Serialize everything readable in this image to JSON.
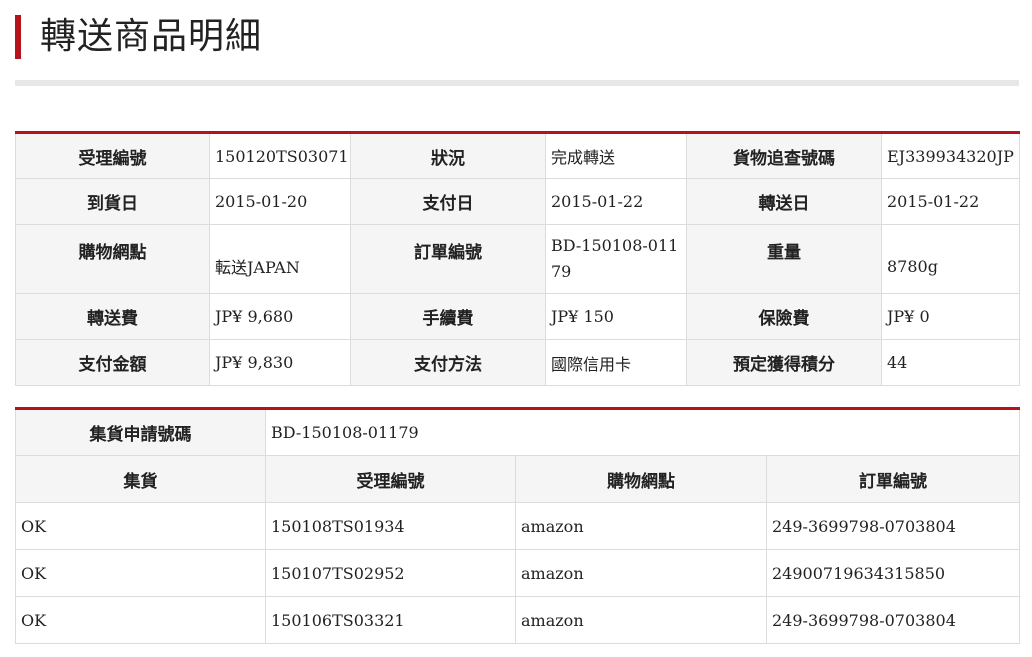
{
  "page": {
    "title": "轉送商品明細"
  },
  "details": {
    "rows": [
      [
        {
          "label": "受理編號",
          "value": "150120TS03071"
        },
        {
          "label": "狀況",
          "value": "完成轉送"
        },
        {
          "label": "貨物追查號碼",
          "value": "EJ339934320JP"
        }
      ],
      [
        {
          "label": "到貨日",
          "value": "2015-01-20"
        },
        {
          "label": "支付日",
          "value": "2015-01-22"
        },
        {
          "label": "轉送日",
          "value": "2015-01-22"
        }
      ],
      [
        {
          "label": "購物網點",
          "value": "転送JAPAN"
        },
        {
          "label": "訂單編號",
          "value": "BD-150108-01179"
        },
        {
          "label": "重量",
          "value": "8780g"
        }
      ],
      [
        {
          "label": "轉送費",
          "value": "JP¥ 9,680"
        },
        {
          "label": "手續費",
          "value": "JP¥ 150"
        },
        {
          "label": "保險費",
          "value": "JP¥ 0"
        }
      ],
      [
        {
          "label": "支付金額",
          "value": "JP¥ 9,830"
        },
        {
          "label": "支付方法",
          "value": "國際信用卡"
        },
        {
          "label": "預定獲得積分",
          "value": "44"
        }
      ]
    ]
  },
  "consolidation": {
    "request_label": "集貨申請號碼",
    "request_value": "BD-150108-01179",
    "headers": [
      "集貨",
      "受理編號",
      "購物網點",
      "訂單編號"
    ],
    "rows": [
      [
        "OK",
        "150108TS01934",
        "amazon",
        "249-3699798-0703804"
      ],
      [
        "OK",
        "150107TS02952",
        "amazon",
        "24900719634315850"
      ],
      [
        "OK",
        "150106TS03321",
        "amazon",
        "249-3699798-0703804"
      ]
    ]
  }
}
